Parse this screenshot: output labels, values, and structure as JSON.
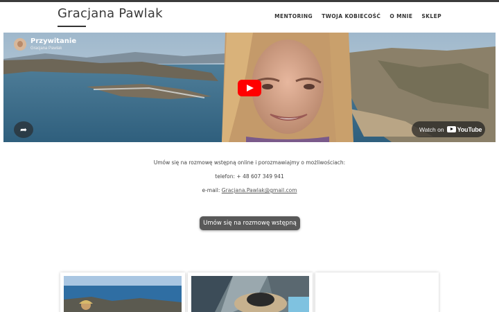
{
  "site": {
    "title": "Gracjana Pawlak"
  },
  "nav": {
    "items": [
      "MENTORING",
      "TWOJA KOBIECOŚĆ",
      "O MNIE",
      "SKLEP"
    ]
  },
  "video": {
    "title": "Przywitanie",
    "channel": "Gracjana Pawlak",
    "watch_label": "Watch on",
    "platform": "YouTube"
  },
  "contact": {
    "intro": "Umów się na rozmowę wstępną online i porozmawiajmy o możliwościach:",
    "phone_text": "telefon: + 48 607 349 941",
    "email_label": "e-mail: ",
    "email": "Gracjana.Pawlak@gmail.com"
  },
  "cta": {
    "label": "Umów się na rozmowę wstępną"
  },
  "colors": {
    "accent": "#595959",
    "youtube_red": "#ff0000",
    "topbar": "#3b3b3b"
  }
}
